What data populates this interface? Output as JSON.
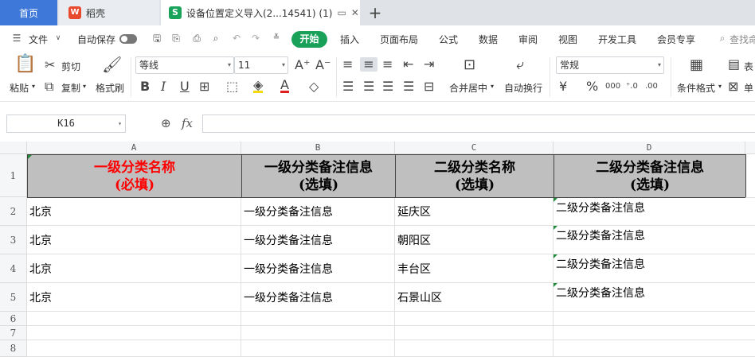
{
  "tabs": {
    "home": "首页",
    "docer": "稻壳",
    "file": "设备位置定义导入(2...14541) (1)",
    "add": "+"
  },
  "menu": {
    "file": "文件",
    "autosave": "自动保存",
    "start": "开始",
    "items": [
      "插入",
      "页面布局",
      "公式",
      "数据",
      "审阅",
      "视图",
      "开发工具",
      "会员专享"
    ],
    "search": "查找命"
  },
  "ribbon": {
    "paste": "粘贴",
    "cut": "剪切",
    "copy": "复制",
    "format_painter": "格式刷",
    "font_name": "等线",
    "font_size": "11",
    "merge_center": "合并居中",
    "wrap_text": "自动换行",
    "number_format": "常规",
    "conditional_format": "条件格式",
    "table_label": "表",
    "single_label": "单"
  },
  "formula_bar": {
    "name_box": "K16",
    "fx": "fx",
    "value": ""
  },
  "sheet": {
    "columns": [
      "A",
      "B",
      "C",
      "D"
    ],
    "rows": [
      "1",
      "2",
      "3",
      "4",
      "5",
      "6",
      "7",
      "8"
    ],
    "header": {
      "a_line1": "一级分类名称",
      "a_line2": "(必填)",
      "b_line1": "一级分类备注信息",
      "b_line2": "(选填)",
      "c_line1": "二级分类名称",
      "c_line2": "(选填)",
      "d_line1": "二级分类备注信息",
      "d_line2": "(选填)"
    },
    "data": [
      {
        "a": "北京",
        "b": "一级分类备注信息",
        "c": "延庆区",
        "d": "二级分类备注信息"
      },
      {
        "a": "北京",
        "b": "一级分类备注信息",
        "c": "朝阳区",
        "d": "二级分类备注信息"
      },
      {
        "a": "北京",
        "b": "一级分类备注信息",
        "c": "丰台区",
        "d": "二级分类备注信息"
      },
      {
        "a": "北京",
        "b": "一级分类备注信息",
        "c": "石景山区",
        "d": "二级分类备注信息"
      }
    ]
  },
  "colors": {
    "accent": "#19a15a",
    "home_tab": "#3e78d8",
    "header_fill": "#bfbfbf",
    "required_text": "#ff0000"
  }
}
